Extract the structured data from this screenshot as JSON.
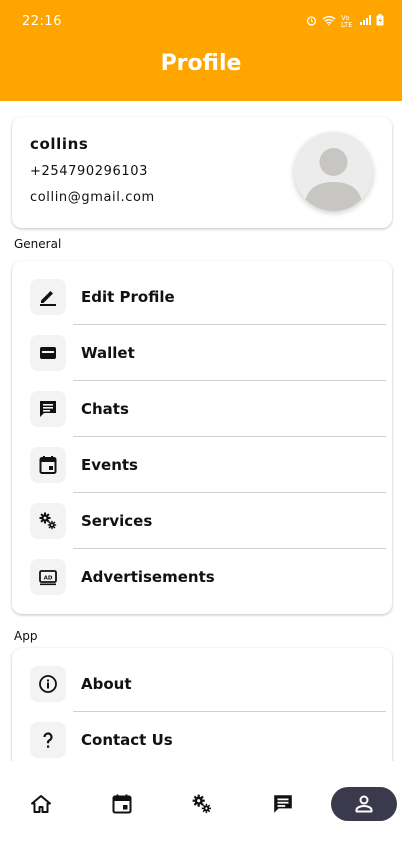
{
  "status_bar": {
    "time": "22:16",
    "network_label": "Vo LTE"
  },
  "header": {
    "title": "Profile",
    "color": "#FFA500"
  },
  "profile": {
    "name": "collins",
    "phone": "+254790296103",
    "email": "collin@gmail.com"
  },
  "general": {
    "label": "General",
    "items": [
      {
        "label": "Edit Profile",
        "icon": "edit-icon"
      },
      {
        "label": "Wallet",
        "icon": "wallet-icon"
      },
      {
        "label": "Chats",
        "icon": "chat-icon"
      },
      {
        "label": "Events",
        "icon": "calendar-icon"
      },
      {
        "label": "Services",
        "icon": "gears-icon"
      },
      {
        "label": "Advertisements",
        "icon": "ad-icon"
      }
    ]
  },
  "app": {
    "label": "App",
    "items": [
      {
        "label": "About",
        "icon": "info-icon"
      },
      {
        "label": "Contact Us",
        "icon": "question-icon"
      }
    ]
  },
  "bottom_nav": {
    "items": [
      {
        "icon": "home-icon"
      },
      {
        "icon": "calendar-icon"
      },
      {
        "icon": "gears-icon"
      },
      {
        "icon": "chat-icon"
      },
      {
        "icon": "person-icon",
        "active": true
      }
    ],
    "active_color": "#3b3a4d"
  }
}
